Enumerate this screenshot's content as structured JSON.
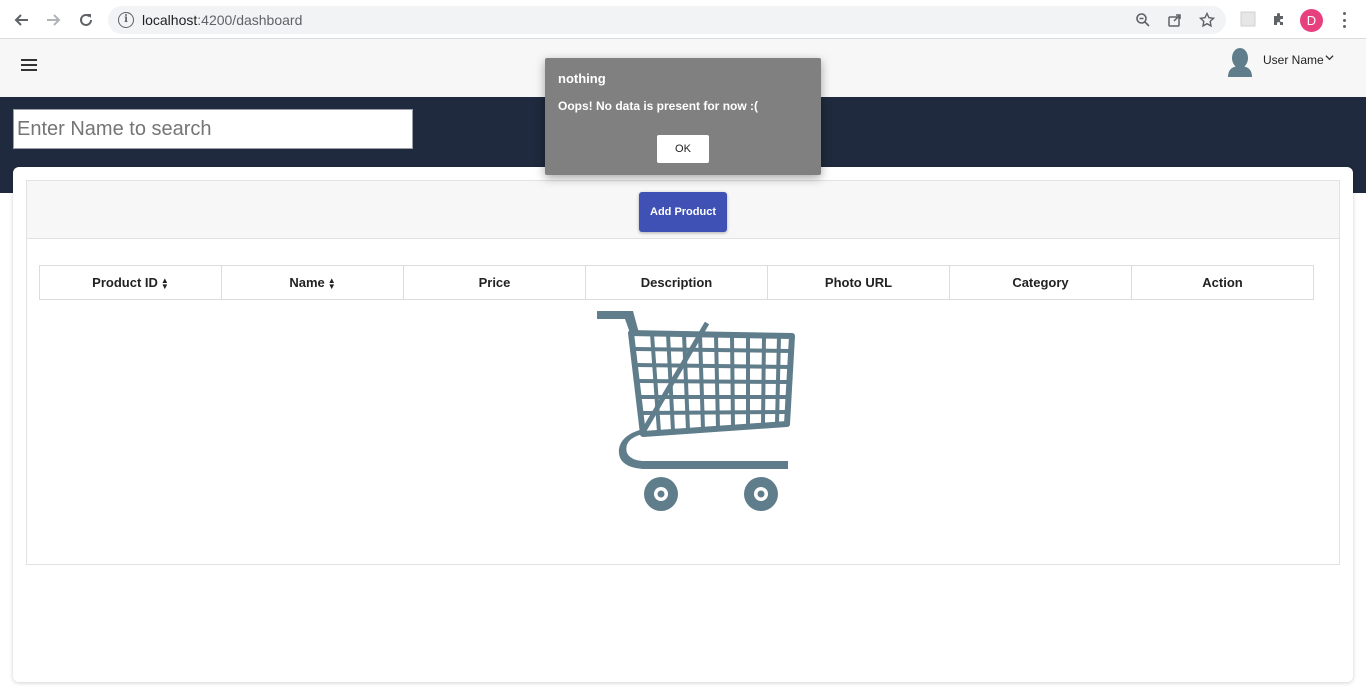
{
  "browser": {
    "url_host": "localhost",
    "url_rest": ":4200/dashboard",
    "profile_initial": "D"
  },
  "header": {
    "user_name": "User Name"
  },
  "search": {
    "placeholder": "Enter Name to search"
  },
  "toolbar": {
    "add_label": "Add Product"
  },
  "table": {
    "columns": [
      "Product ID",
      "Name",
      "Price",
      "Description",
      "Photo URL",
      "Category",
      "Action"
    ]
  },
  "dialog": {
    "title": "nothing",
    "message": "Oops! No data is present for now :(",
    "ok_label": "OK"
  },
  "colors": {
    "band": "#1f2a3e",
    "primary_button": "#3f51b5",
    "cart": "#607d8b",
    "dialog_bg": "#808080",
    "profile_avatar": "#e8407f"
  }
}
